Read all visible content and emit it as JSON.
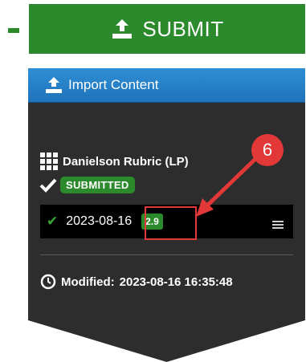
{
  "submit": {
    "label": "SUBMIT",
    "icon": "upload-tray-icon"
  },
  "panel": {
    "header": {
      "title": "Import Content",
      "icon": "upload-tray-icon"
    },
    "rubric": {
      "title": "Danielson Rubric (LP)",
      "icon": "grid-icon"
    },
    "status": {
      "label": "SUBMITTED",
      "icon": "checkmark-icon"
    },
    "entry": {
      "date": "2023-08-16",
      "score": "2.9",
      "check_icon": "checkmark-icon",
      "menu_icon": "hamburger-icon"
    },
    "modified": {
      "label": "Modified:",
      "value": "2023-08-16 16:35:48",
      "icon": "clock-icon"
    }
  },
  "annotation": {
    "step_number": "6",
    "color": "#e23838"
  },
  "colors": {
    "green": "#2b8a2b",
    "blue": "#1f73bb",
    "panel_bg": "#2d2d2d"
  }
}
